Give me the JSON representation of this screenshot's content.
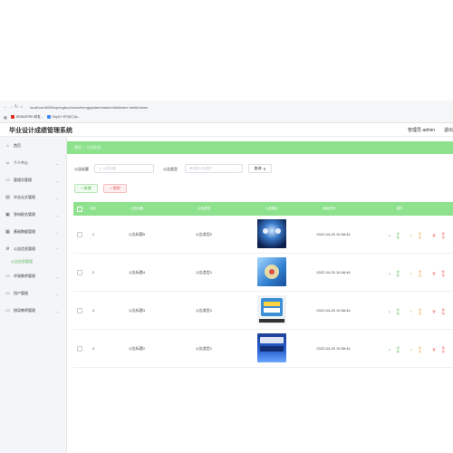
{
  "browser": {
    "url": "localhost:8080/springboot/ssmzhengjsystem/admin/dist/index.html#/news",
    "tabs": [
      {
        "label": "DEMO/ERD 研发..."
      },
      {
        "label": "Org10~SF/(SCJ)s..."
      }
    ]
  },
  "app": {
    "title": "毕业设计成绩管理系统",
    "user": "管理员 admin",
    "logout": "退出"
  },
  "sidebar": {
    "items": [
      {
        "label": "首页",
        "icon": "home-icon"
      },
      {
        "label": "个人中心",
        "icon": "person-icon"
      },
      {
        "label": "管理员管理",
        "icon": "admin-icon"
      },
      {
        "label": "毕业论文管理",
        "icon": "paper-icon"
      },
      {
        "label": "答辩报名管理",
        "icon": "signup-icon"
      },
      {
        "label": "基础数据管理",
        "icon": "data-icon"
      },
      {
        "label": "公告信息管理",
        "icon": "notice-icon"
      }
    ],
    "sub_item": "公告信息管理",
    "items2": [
      {
        "label": "评阅教师管理",
        "icon": "review-icon"
      },
      {
        "label": "用户管理",
        "icon": "user-icon"
      },
      {
        "label": "指导教师管理",
        "icon": "teacher-icon"
      }
    ]
  },
  "breadcrumb": {
    "home": "首页",
    "sep": "/",
    "current": "公告信息"
  },
  "search": {
    "title_label": "公告标题",
    "title_placeholder": "公告标题",
    "type_label": "公告类型",
    "type_placeholder": "请选择公告类型",
    "query_label": "查询",
    "add_label": "+ 新增",
    "delete_label": "× 删除"
  },
  "table": {
    "headers": [
      "",
      "索引",
      "公告标题",
      "公告类型",
      "公告图片",
      "添加时间",
      "操作"
    ],
    "rows": [
      {
        "index": "1",
        "title": "公告标题5",
        "type": "公告类型2",
        "time": "2022-04-25 10:38:44"
      },
      {
        "index": "2",
        "title": "公告标题4",
        "type": "公告类型1",
        "time": "2022-04-25 10:38:44"
      },
      {
        "index": "3",
        "title": "公告标题3",
        "type": "公告类型1",
        "time": "2022-04-25 10:38:44"
      },
      {
        "index": "4",
        "title": "公告标题2",
        "type": "公告类型1",
        "time": "2022-04-25 10:38:44"
      }
    ],
    "ops": {
      "view": "详情",
      "edit": "修改",
      "delete": "删除"
    }
  },
  "colors": {
    "accent": "#8ee28e",
    "sidebar_bg": "#f3f5f8",
    "success": "#49b449",
    "warning": "#e6a23c",
    "danger": "#f56c6c"
  }
}
